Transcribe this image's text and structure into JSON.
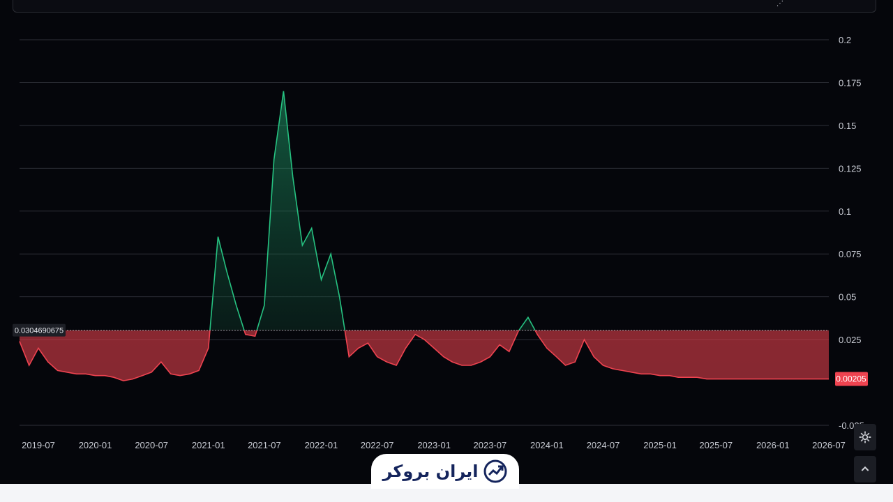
{
  "toolbar": {
    "icon_name": "drawing-tools-icon"
  },
  "chart_data": {
    "type": "area",
    "baseline_value": 0.0304690675,
    "baseline_label": "0.0304690675",
    "last_value": 0.00205,
    "last_value_label": "0.00205",
    "ylim": [
      -0.025,
      0.2
    ],
    "y_ticks": [
      {
        "value": 0.2,
        "label": "0.2"
      },
      {
        "value": 0.175,
        "label": "0.175"
      },
      {
        "value": 0.15,
        "label": "0.15"
      },
      {
        "value": 0.125,
        "label": "0.125"
      },
      {
        "value": 0.1,
        "label": "0.1"
      },
      {
        "value": 0.075,
        "label": "0.075"
      },
      {
        "value": 0.05,
        "label": "0.05"
      },
      {
        "value": 0.025,
        "label": "0.025"
      },
      {
        "value": -0.025,
        "label": "-0.025"
      }
    ],
    "x_ticks": [
      "2019-07",
      "2020-01",
      "2020-07",
      "2021-01",
      "2021-07",
      "2022-01",
      "2022-07",
      "2023-01",
      "2023-07",
      "2024-01",
      "2024-07",
      "2025-01",
      "2025-07",
      "2026-01",
      "2026-07"
    ],
    "grid": true,
    "colors": {
      "above": "#26c281",
      "below": "#ef4350",
      "above_fill": "#0e3b2a",
      "below_fill": "#7a1f25",
      "grid": "#2e3038",
      "baseline": "#9a9ca3"
    },
    "series": [
      {
        "x": [
          "2019-05-01",
          "2019-06-01",
          "2019-07-01",
          "2019-08-01",
          "2019-09-01",
          "2019-10-01",
          "2019-11-01",
          "2019-12-01",
          "2020-01-01",
          "2020-02-01",
          "2020-03-01",
          "2020-04-01",
          "2020-05-01",
          "2020-06-01",
          "2020-07-01",
          "2020-08-01",
          "2020-09-01",
          "2020-10-01",
          "2020-11-01",
          "2020-12-01",
          "2021-01-01",
          "2021-02-01",
          "2021-03-01",
          "2021-04-01",
          "2021-05-01",
          "2021-06-01",
          "2021-07-01",
          "2021-08-01",
          "2021-09-01",
          "2021-10-01",
          "2021-11-01",
          "2021-12-01",
          "2022-01-01",
          "2022-02-01",
          "2022-03-01",
          "2022-04-01",
          "2022-05-01",
          "2022-06-01",
          "2022-07-01",
          "2022-08-01",
          "2022-09-01",
          "2022-10-01",
          "2022-11-01",
          "2022-12-01",
          "2023-01-01",
          "2023-02-01",
          "2023-03-01",
          "2023-04-01",
          "2023-05-01",
          "2023-06-01",
          "2023-07-01",
          "2023-08-01",
          "2023-09-01",
          "2023-10-01",
          "2023-11-01",
          "2023-12-01",
          "2024-01-01",
          "2024-02-01",
          "2024-03-01",
          "2024-04-01",
          "2024-05-01",
          "2024-06-01",
          "2024-07-01",
          "2024-08-01",
          "2024-09-01",
          "2024-10-01",
          "2024-11-01",
          "2024-12-01",
          "2025-01-01",
          "2025-02-01",
          "2025-03-01",
          "2025-04-01",
          "2025-05-01",
          "2025-06-01",
          "2025-07-01",
          "2025-08-01",
          "2025-09-01",
          "2025-10-01",
          "2025-11-01",
          "2025-12-01",
          "2026-01-01",
          "2026-02-01",
          "2026-03-01",
          "2026-04-01",
          "2026-05-01",
          "2026-06-01",
          "2026-07-01"
        ],
        "values": [
          0.024,
          0.01,
          0.02,
          0.012,
          0.007,
          0.006,
          0.005,
          0.005,
          0.004,
          0.004,
          0.003,
          0.001,
          0.002,
          0.004,
          0.006,
          0.012,
          0.005,
          0.004,
          0.005,
          0.007,
          0.02,
          0.085,
          0.065,
          0.045,
          0.028,
          0.027,
          0.045,
          0.13,
          0.17,
          0.12,
          0.08,
          0.09,
          0.06,
          0.075,
          0.05,
          0.015,
          0.02,
          0.023,
          0.015,
          0.012,
          0.01,
          0.02,
          0.028,
          0.025,
          0.02,
          0.015,
          0.012,
          0.01,
          0.01,
          0.012,
          0.015,
          0.022,
          0.018,
          0.03,
          0.038,
          0.028,
          0.02,
          0.015,
          0.01,
          0.012,
          0.025,
          0.015,
          0.01,
          0.008,
          0.007,
          0.006,
          0.005,
          0.005,
          0.004,
          0.004,
          0.003,
          0.003,
          0.003,
          0.002,
          0.002,
          0.002,
          0.002,
          0.002,
          0.002,
          0.002,
          0.002,
          0.002,
          0.002,
          0.002,
          0.002,
          0.002,
          0.002
        ]
      }
    ]
  },
  "side_controls": {
    "settings_icon": "gear-icon",
    "scroll_icon": "chevron-up-icon"
  },
  "brand": {
    "name": "ایران بروکر",
    "icon": "trend-up-icon"
  }
}
